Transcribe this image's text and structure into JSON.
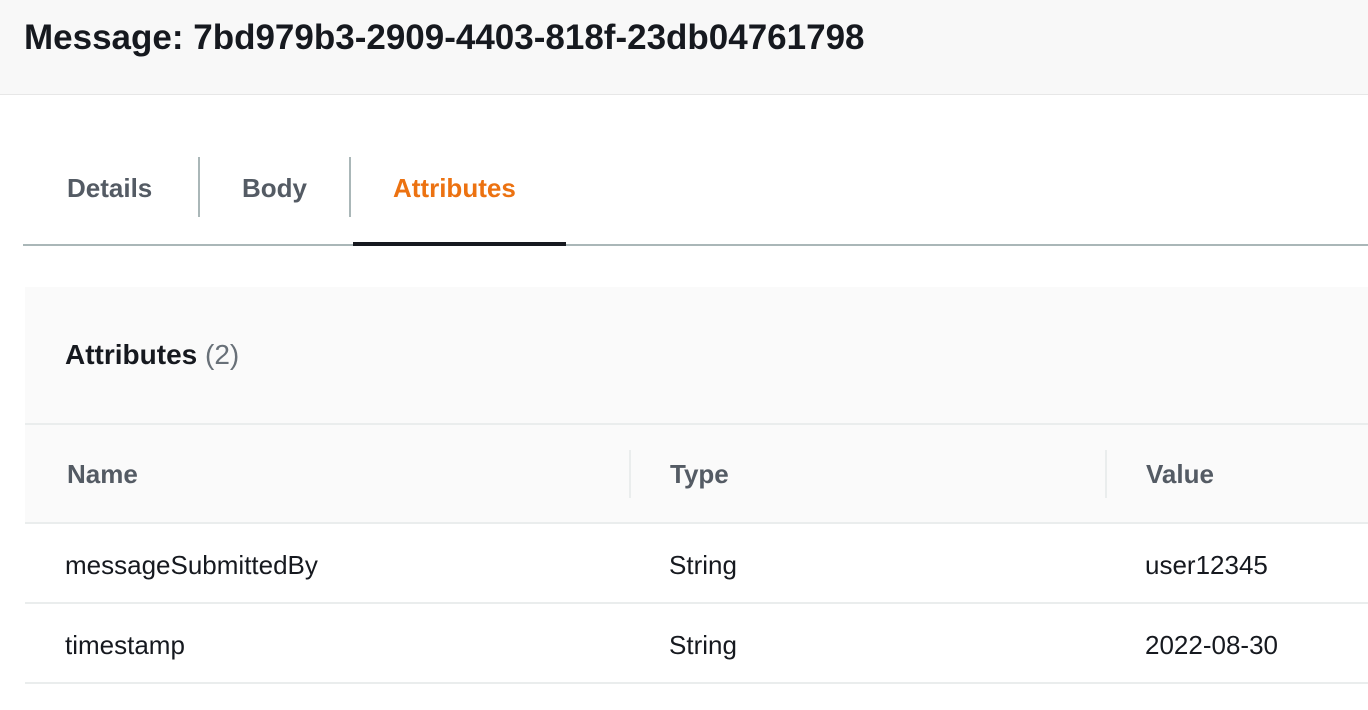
{
  "header": {
    "title": "Message: 7bd979b3-2909-4403-818f-23db04761798"
  },
  "tabs": [
    {
      "label": "Details",
      "active": false
    },
    {
      "label": "Body",
      "active": false
    },
    {
      "label": "Attributes",
      "active": true
    }
  ],
  "attributes_panel": {
    "title": "Attributes",
    "count": "(2)",
    "columns": [
      "Name",
      "Type",
      "Value"
    ],
    "rows": [
      {
        "name": "messageSubmittedBy",
        "type": "String",
        "value": "user12345"
      },
      {
        "name": "timestamp",
        "type": "String",
        "value": "2022-08-30"
      }
    ]
  },
  "colors": {
    "active_tab": "#ec7211",
    "text": "#16191f",
    "muted_text": "#545b64"
  }
}
